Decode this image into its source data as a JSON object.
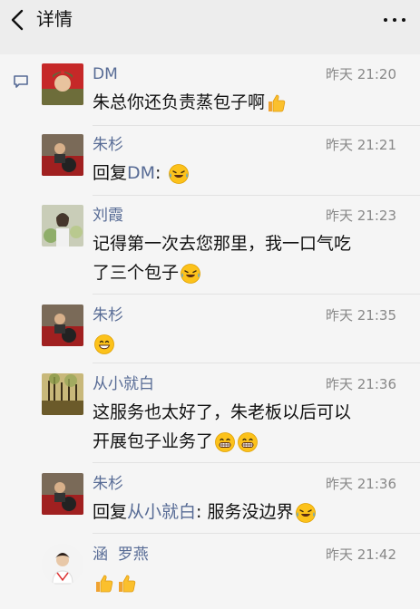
{
  "header": {
    "title": "详情",
    "back_icon": "chevron-left-icon",
    "more_icon": "more-dots-icon"
  },
  "comments": [
    {
      "name": "DM",
      "time": "昨天 21:20",
      "text": "朱总你还负责蒸包子啊",
      "emoji": [
        "thumbs-up"
      ]
    },
    {
      "name": "朱杉",
      "time": "昨天 21:21",
      "reply_prefix": "回复",
      "reply_to": "DM",
      "reply_sep": ":",
      "text": "",
      "emoji": [
        "laugh-cry"
      ]
    },
    {
      "name": "刘霞",
      "time": "昨天 21:23",
      "text_line1": "记得第一次去您那里，我一口气吃",
      "text_line2": "了三个包子",
      "emoji": [
        "laugh-cry"
      ]
    },
    {
      "name": "朱杉",
      "time": "昨天 21:35",
      "text": "",
      "emoji": [
        "smile"
      ]
    },
    {
      "name": "从小就白",
      "time": "昨天 21:36",
      "text_line1": "这服务也太好了，朱老板以后可以",
      "text_line2": "开展包子业务了",
      "emoji": [
        "grin",
        "grin"
      ]
    },
    {
      "name": "朱杉",
      "time": "昨天 21:36",
      "reply_prefix": "回复",
      "reply_to": "从小就白",
      "reply_sep": ": ",
      "text": "服务没边界",
      "emoji": [
        "laugh-cry"
      ]
    },
    {
      "name": "涵  罗燕",
      "time": "昨天 21:42",
      "text": "",
      "emoji": [
        "thumbs-up",
        "thumbs-up"
      ]
    }
  ]
}
